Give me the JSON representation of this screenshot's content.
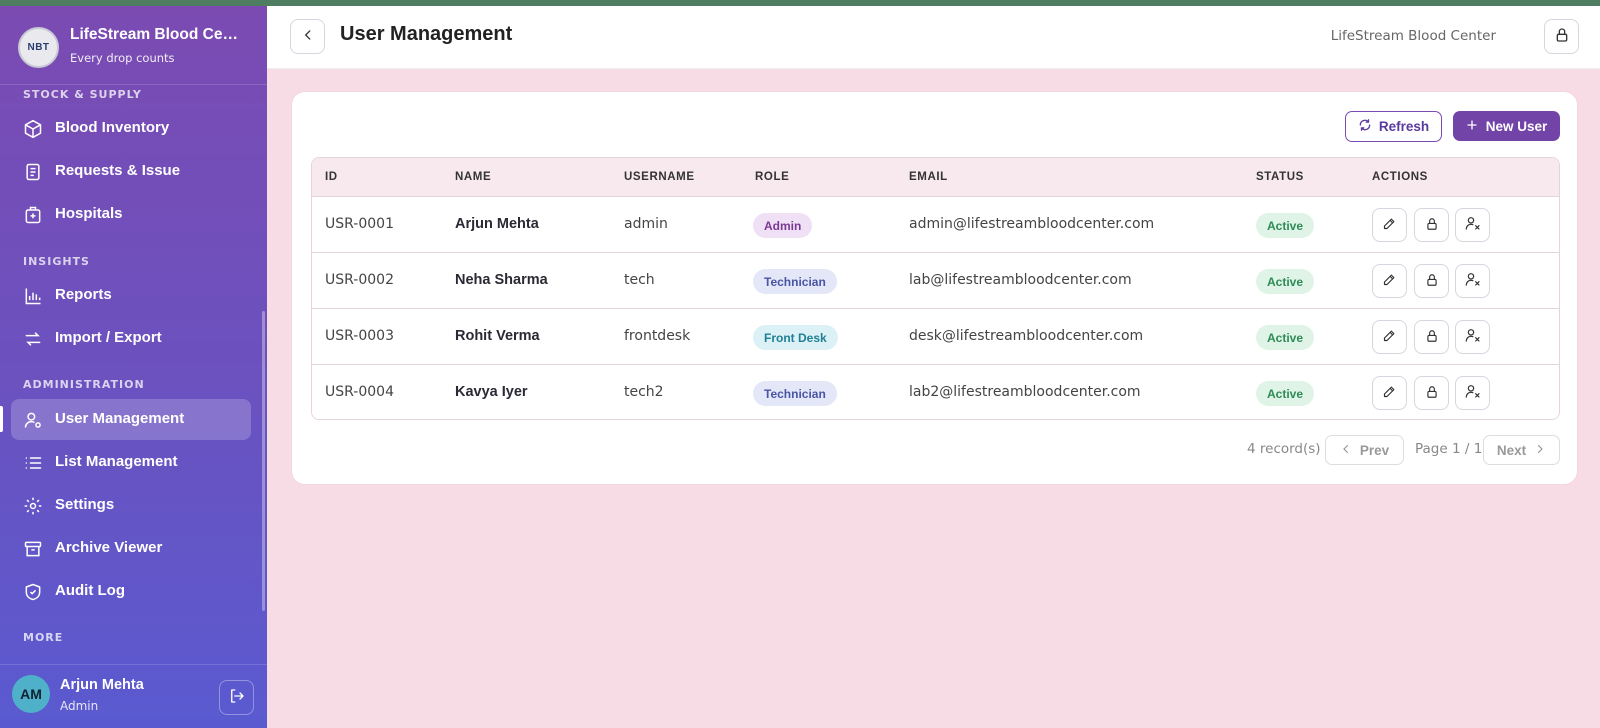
{
  "brand": {
    "title": "LifeStream Blood Center",
    "subtitle": "Every drop counts",
    "logo_text": "NBT"
  },
  "sidebar": {
    "sections": [
      {
        "label": "STOCK & SUPPLY"
      },
      {
        "label": "INSIGHTS"
      },
      {
        "label": "ADMINISTRATION"
      },
      {
        "label": "MORE"
      }
    ],
    "items": [
      {
        "label": "Blood Inventory",
        "icon": "box-icon"
      },
      {
        "label": "Requests & Issue",
        "icon": "document-icon"
      },
      {
        "label": "Hospitals",
        "icon": "hospital-icon"
      },
      {
        "label": "Reports",
        "icon": "bar-chart-icon"
      },
      {
        "label": "Import / Export",
        "icon": "swap-icon"
      },
      {
        "label": "User Management",
        "icon": "user-gear-icon",
        "active": true
      },
      {
        "label": "List Management",
        "icon": "list-icon"
      },
      {
        "label": "Settings",
        "icon": "gear-icon"
      },
      {
        "label": "Archive Viewer",
        "icon": "archive-icon"
      },
      {
        "label": "Audit Log",
        "icon": "shield-check-icon"
      }
    ],
    "user": {
      "initials": "AM",
      "name": "Arjun Mehta",
      "role": "Admin"
    }
  },
  "header": {
    "title": "User Management",
    "org": "LifeStream Blood Center"
  },
  "toolbar": {
    "refresh_label": "Refresh",
    "new_user_label": "New User"
  },
  "table": {
    "columns": [
      "ID",
      "NAME",
      "USERNAME",
      "ROLE",
      "EMAIL",
      "STATUS",
      "ACTIONS"
    ],
    "rows": [
      {
        "id": "USR-0001",
        "name": "Arjun Mehta",
        "username": "admin",
        "role": "Admin",
        "email": "admin@lifestreambloodcenter.com",
        "status": "Active"
      },
      {
        "id": "USR-0002",
        "name": "Neha Sharma",
        "username": "tech",
        "role": "Technician",
        "email": "lab@lifestreambloodcenter.com",
        "status": "Active"
      },
      {
        "id": "USR-0003",
        "name": "Rohit Verma",
        "username": "frontdesk",
        "role": "Front Desk",
        "email": "desk@lifestreambloodcenter.com",
        "status": "Active"
      },
      {
        "id": "USR-0004",
        "name": "Kavya Iyer",
        "username": "tech2",
        "role": "Technician",
        "email": "lab2@lifestreambloodcenter.com",
        "status": "Active"
      }
    ]
  },
  "pager": {
    "count": "4 record(s)",
    "prev": "Prev",
    "page": "Page 1 / 1",
    "next": "Next"
  },
  "colors": {
    "accent": "#7344a8",
    "page_bg": "#f7dbe5",
    "active_green": "#2e8b57"
  }
}
